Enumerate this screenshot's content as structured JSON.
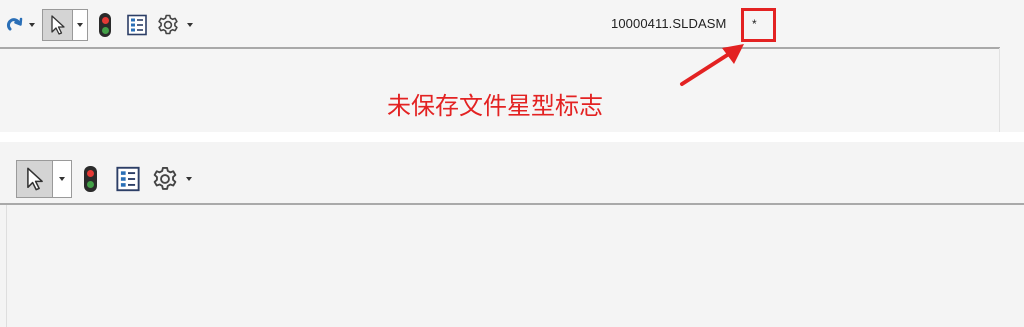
{
  "document": {
    "title": "10000411.SLDASM",
    "unsaved_marker": "*"
  },
  "annotation": {
    "text": "未保存文件星型标志",
    "color": "#e32222"
  },
  "toolbar_top": {
    "icons": [
      "redo-icon",
      "select-arrow-icon",
      "traffic-light-icon",
      "options-list-icon",
      "gear-icon"
    ]
  },
  "toolbar_bottom": {
    "icons": [
      "select-arrow-icon",
      "traffic-light-icon",
      "options-list-icon",
      "gear-icon"
    ]
  },
  "colors": {
    "toolbar_bg": "#f5f5f5",
    "separator": "#a9a9a9",
    "highlight": "#e32222"
  }
}
